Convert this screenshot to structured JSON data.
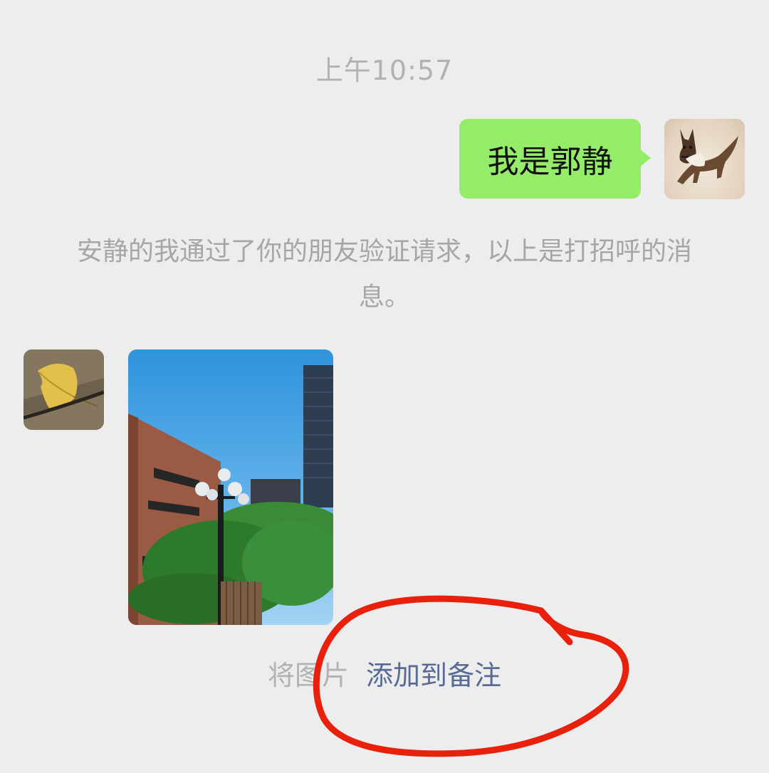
{
  "chat": {
    "timestamp": "上午10:57",
    "sent_message": "我是郭静",
    "system_notice": "安静的我通过了你的朋友验证请求，以上是打招呼的消息。",
    "photo_hint": "将图片",
    "photo_action": "添加到备注"
  },
  "colors": {
    "background": "#ededed",
    "sent_bubble": "#95ec69",
    "link": "#576b95",
    "annotation_circle": "#e8200c"
  },
  "icons": {
    "my_avatar": "dog-avatar-icon",
    "other_avatar": "leaf-avatar-icon"
  }
}
